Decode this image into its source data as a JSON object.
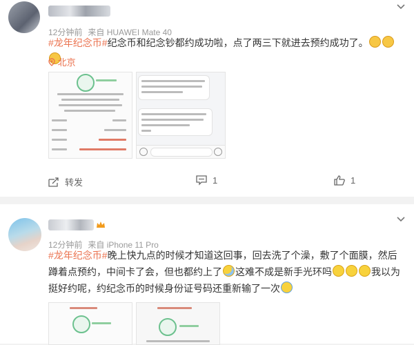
{
  "posts": [
    {
      "time": "12分钟前",
      "source": "来自 HUAWEI Mate 40",
      "topic": "#龙年纪念币#",
      "body": "纪念币和纪念钞都约成功啦，点了两三下就进去预约成功了。",
      "location": "北京",
      "icons": {
        "emoji": "cat-face-icon",
        "location": "location-pin-icon"
      },
      "actions": {
        "share": "转发",
        "comment": "1",
        "like": "1"
      }
    },
    {
      "time": "12分钟前",
      "source": "来自 iPhone 11 Pro",
      "topic": "#龙年纪念币#",
      "body_1": "晚上快九点的时候才知道这回事，回去洗了个澡，敷了个面膜，然后蹲着点预约，中间卡了会，但也都约上了",
      "body_2": "这难不成是新手光环吗",
      "body_3": "我以为挺好约呢，约纪念币的时候身份证号码还重新输了一次"
    }
  ],
  "colors": {
    "topic": "#eb7350",
    "success_green": "#6cc18e",
    "vip": "#f29b1d"
  }
}
